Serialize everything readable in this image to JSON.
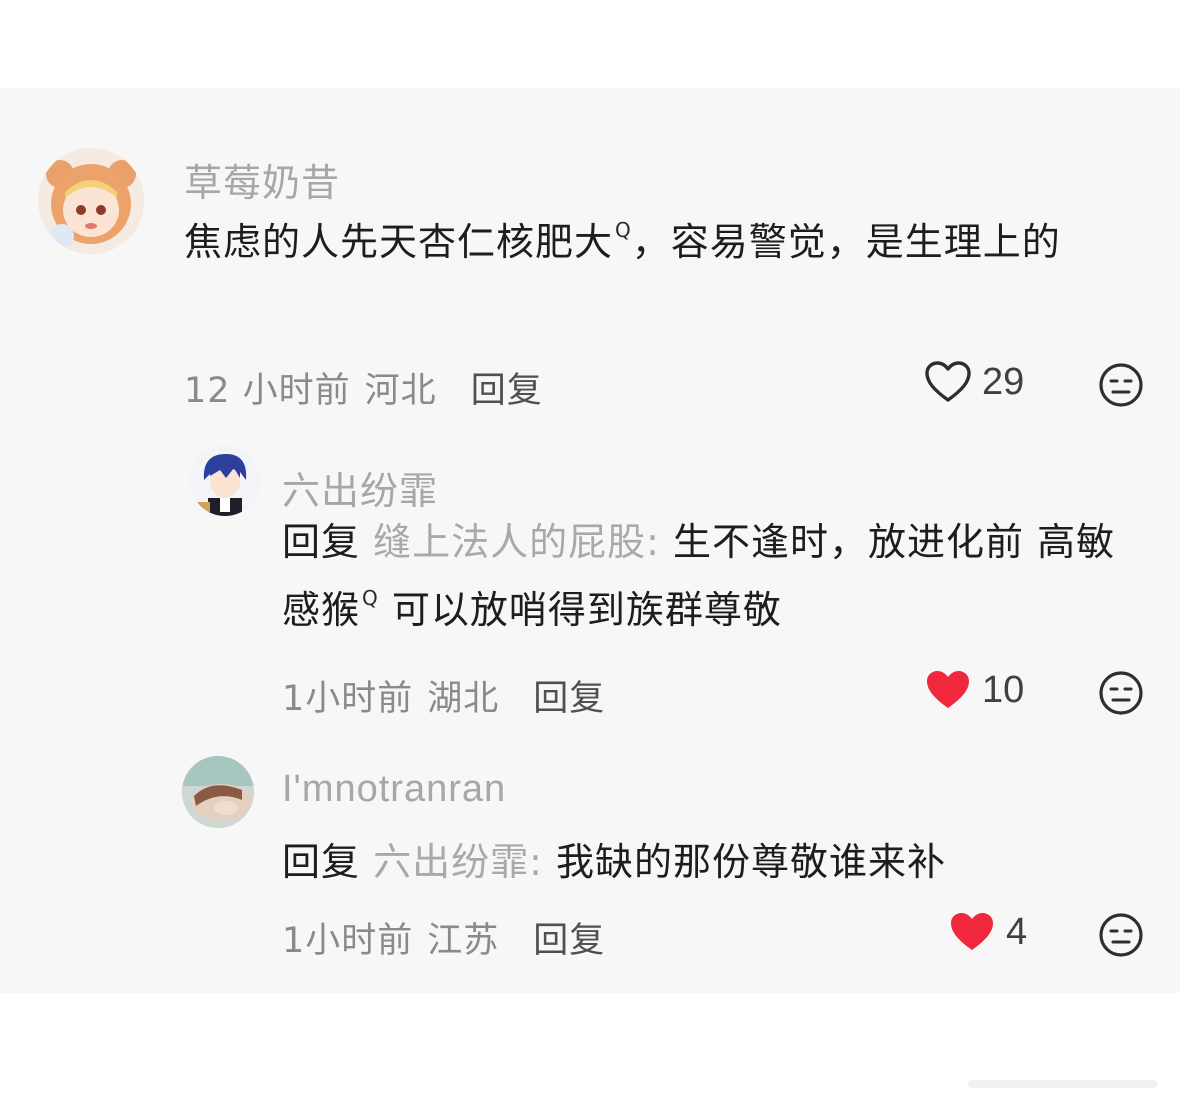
{
  "comments": [
    {
      "username": "草莓奶昔",
      "text_before_mark": "焦虑的人先天杏仁核肥大",
      "text_after_mark": "，容易警觉，是生理上的",
      "time": "12 小时前",
      "region": "河北",
      "reply_label": "回复",
      "like_count": "29",
      "liked": false,
      "avatar_icon": "anime-girl-hood-avatar"
    },
    {
      "username": "六出纷霏",
      "reply_prefix": "回复",
      "reply_target": "缝上法人的屁股:",
      "text_before_mark": " 生不逢时，放进化前 高敏感猴",
      "text_after_mark": " 可以放哨得到族群尊敬",
      "time": "1小时前",
      "region": "湖北",
      "reply_label": "回复",
      "like_count": "10",
      "liked": true,
      "avatar_icon": "anime-boy-blue-hair-avatar"
    },
    {
      "username": "I'mnotranran",
      "reply_prefix": "回复",
      "reply_target": "六出纷霏:",
      "text": " 我缺的那份尊敬谁来补",
      "time": "1小时前",
      "region": "江苏",
      "reply_label": "回复",
      "like_count": "4",
      "liked": true,
      "avatar_icon": "sleeping-person-photo-avatar"
    }
  ],
  "search_mark": "Q",
  "colors": {
    "liked_heart": "#f0283c",
    "username": "#a7a7ab",
    "text": "#1d1d1f",
    "panel_bg": "#f7f7f8"
  }
}
